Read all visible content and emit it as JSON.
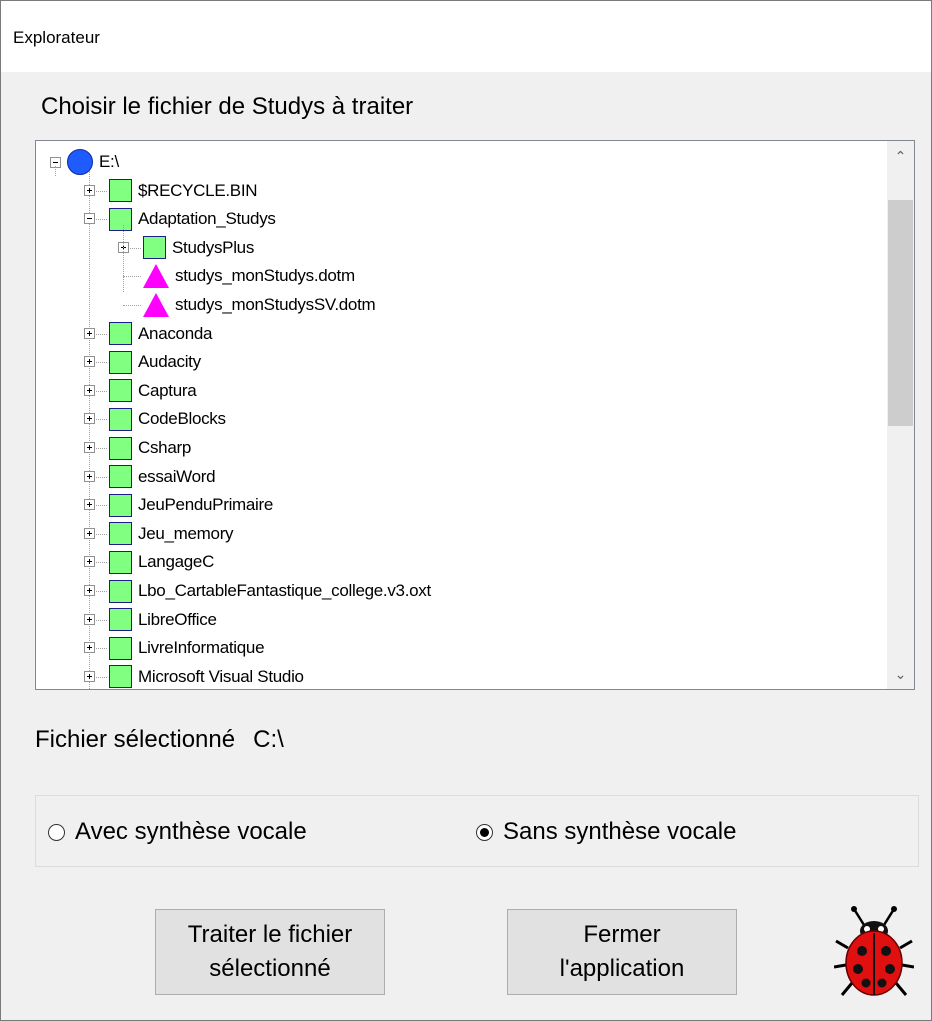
{
  "window": {
    "title": "Explorateur"
  },
  "heading": "Choisir le fichier de Studys à traiter",
  "tree": {
    "root": {
      "label": "E:\\",
      "icon": "drive-icon"
    },
    "items": [
      {
        "label": "$RECYCLE.BIN",
        "type": "folder",
        "level": 1,
        "expander": "plus"
      },
      {
        "label": "Adaptation_Studys",
        "type": "folder",
        "level": 1,
        "expander": "minus"
      },
      {
        "label": "StudysPlus",
        "type": "folder",
        "level": 2,
        "expander": "plus"
      },
      {
        "label": "studys_monStudys.dotm",
        "type": "file",
        "level": 2,
        "expander": "none"
      },
      {
        "label": "studys_monStudysSV.dotm",
        "type": "file",
        "level": 2,
        "expander": "none"
      },
      {
        "label": "Anaconda",
        "type": "folder",
        "level": 1,
        "expander": "plus"
      },
      {
        "label": "Audacity",
        "type": "folder",
        "level": 1,
        "expander": "plus"
      },
      {
        "label": "Captura",
        "type": "folder",
        "level": 1,
        "expander": "plus"
      },
      {
        "label": "CodeBlocks",
        "type": "folder",
        "level": 1,
        "expander": "plus"
      },
      {
        "label": "Csharp",
        "type": "folder",
        "level": 1,
        "expander": "plus"
      },
      {
        "label": "essaiWord",
        "type": "folder",
        "level": 1,
        "expander": "plus"
      },
      {
        "label": "JeuPenduPrimaire",
        "type": "folder",
        "level": 1,
        "expander": "plus"
      },
      {
        "label": "Jeu_memory",
        "type": "folder",
        "level": 1,
        "expander": "plus"
      },
      {
        "label": "LangageC",
        "type": "folder",
        "level": 1,
        "expander": "plus"
      },
      {
        "label": "Lbo_CartableFantastique_college.v3.oxt",
        "type": "folder",
        "level": 1,
        "expander": "plus"
      },
      {
        "label": "LibreOffice",
        "type": "folder",
        "level": 1,
        "expander": "plus"
      },
      {
        "label": "LivreInformatique",
        "type": "folder",
        "level": 1,
        "expander": "plus"
      },
      {
        "label": "Microsoft Visual Studio",
        "type": "folder",
        "level": 1,
        "expander": "plus"
      }
    ]
  },
  "selected_file": {
    "label": "Fichier sélectionné",
    "value": "C:\\"
  },
  "options": {
    "with_voice": "Avec synthèse vocale",
    "without_voice": "Sans synthèse vocale",
    "selected": "without_voice"
  },
  "buttons": {
    "process_line1": "Traiter le fichier",
    "process_line2": "sélectionné",
    "close_line1": "Fermer",
    "close_line2": "l'application"
  },
  "colors": {
    "folder": "#80ff80",
    "file": "#ff00ff",
    "drive": "#1f5cff",
    "ladybug": "#e01010"
  }
}
